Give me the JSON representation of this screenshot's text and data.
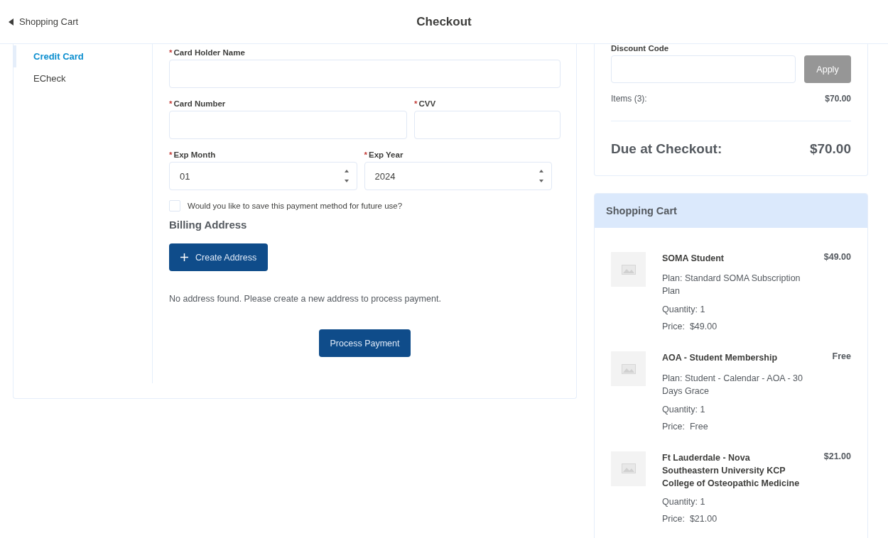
{
  "header": {
    "back_link": "Shopping Cart",
    "title": "Checkout"
  },
  "payment_methods": [
    {
      "label": "Credit Card",
      "selected": true
    },
    {
      "label": "ECheck",
      "selected": false
    }
  ],
  "form": {
    "required_mark": "*",
    "card_holder_name": {
      "label": "Card Holder Name",
      "required": true
    },
    "card_number": {
      "label": "Card Number",
      "required": true
    },
    "cvv": {
      "label": "CVV",
      "required": true
    },
    "exp_month": {
      "label": "Exp Month",
      "required": true,
      "value": "01"
    },
    "exp_year": {
      "label": "Exp Year",
      "required": true,
      "value": "2024"
    },
    "save_method": {
      "label": "Would you like to save this payment method for future use?",
      "checked": false
    }
  },
  "billing": {
    "heading": "Billing Address",
    "create_button": "Create Address",
    "message": "No address found. Please create a new address to process payment.",
    "submit_button": "Process Payment"
  },
  "summary": {
    "discount_label": "Discount Code",
    "apply_button": "Apply",
    "apply_disabled": true,
    "items_label": "Items (3):",
    "items_total": "$70.00",
    "due_label": "Due at Checkout:",
    "due_total": "$70.00"
  },
  "cart": {
    "title": "Shopping Cart",
    "items": [
      {
        "name": "SOMA Student",
        "price": "$49.00",
        "plan": "Plan: Standard SOMA Subscription Plan",
        "quantity": "Quantity: 1",
        "price_line": "Price:  $49.00"
      },
      {
        "name": "AOA - Student Membership",
        "price": "Free",
        "plan": "Plan: Student - Calendar - AOA - 30 Days Grace",
        "quantity": "Quantity: 1",
        "price_line": "Price:  Free"
      },
      {
        "name": "Ft Lauderdale - Nova Southeastern University KCP College of Osteopathic Medicine",
        "price": "$21.00",
        "quantity": "Quantity: 1",
        "price_line": "Price:  $21.00"
      }
    ]
  }
}
